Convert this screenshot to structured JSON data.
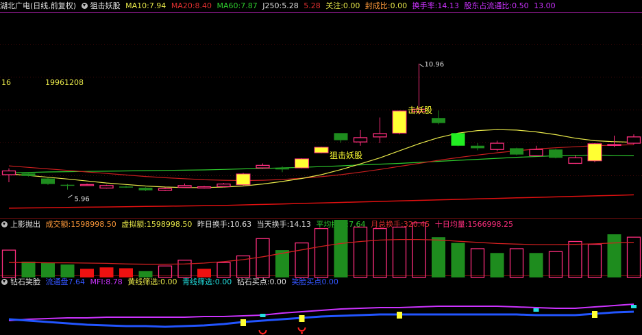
{
  "main_header": {
    "symbol": "湖北广电",
    "period": "(日线,前复权)",
    "indicator": "狙击妖股",
    "ma10_label": "MA10:",
    "ma10_value": "7.94",
    "ma20_label": "MA20:",
    "ma20_value": "8.40",
    "ma60_label": "MA60:",
    "ma60_value": "7.87",
    "j250_label": "J250:",
    "j250_value": "5.28",
    "v5_value": "5.28",
    "guanzhu_label": "关注:",
    "guanzhu_value": "0.00",
    "fengchengbi_label": "封成比:",
    "fengchengbi_value": "0.00",
    "huanshou_label": "换手率:",
    "huanshou_value": "14.13",
    "gudong_label": "股东占流通比:",
    "gudong_value": "0.50",
    "gudong_value2": "13.00"
  },
  "main_overlay": {
    "left_num": "16",
    "date_text": "19961208",
    "high_label": "10.96",
    "low_label": "5.96",
    "signal_text_1": "狙击妖股",
    "signal_text_2": "击妖股"
  },
  "volume_header": {
    "name": "上影抛出",
    "chengjiao_label": "成交额:",
    "chengjiao_value": "1598998.50",
    "xuni_label": "虚拟额:",
    "xuni_value": "1598998.50",
    "zuori_label": "昨日换手:",
    "zuori_value": "10.63",
    "dangtian_label": "当天换手:",
    "dangtian_value": "14.13",
    "pingjun_label": "平均换手:",
    "pingjun_value": "7.64",
    "yuezong_label": "月总换手:",
    "yuezong_value": "320.45",
    "shiri_label": "十日均量:",
    "shiri_value": "1566998.25"
  },
  "bottom_header": {
    "name": "钻石笑脸",
    "a_label": "流通盘",
    "a_value": "7.64",
    "mfi_label": "MFI:",
    "mfi_value": "8.78",
    "huang_label": "黄线筛选:",
    "huang_value": "0.00",
    "qing_label": "青线筛选:",
    "qing_value": "0.00",
    "mai_label": "钻石买点:",
    "mai_value": "0.00",
    "z_label": "笑脸买点",
    "z_value": "0.00"
  },
  "colors": {
    "up": "#ff2e7e",
    "down": "#1e8c1e",
    "ma10": "#e8e84a",
    "ma20": "#c81e1e",
    "ma60": "#2ecc2e",
    "long": "#e01010",
    "signal": "#ffff33",
    "cyan": "#22e0e0",
    "blue": "#2255ff",
    "magenta": "#cc33ff"
  },
  "chart_data": {
    "type": "candlestick",
    "candles": [
      {
        "o": 6.55,
        "h": 6.8,
        "l": 6.25,
        "c": 6.7,
        "signal": false
      },
      {
        "o": 6.6,
        "h": 6.65,
        "l": 6.48,
        "c": 6.5,
        "signal": false
      },
      {
        "o": 6.4,
        "h": 6.42,
        "l": 6.15,
        "c": 6.18,
        "signal": false
      },
      {
        "o": 6.15,
        "h": 6.18,
        "l": 5.96,
        "c": 6.14,
        "signal": false
      },
      {
        "o": 6.14,
        "h": 6.2,
        "l": 6.1,
        "c": 6.16,
        "signal": false
      },
      {
        "o": 6.02,
        "h": 6.15,
        "l": 6.0,
        "c": 6.12,
        "signal": false
      },
      {
        "o": 6.08,
        "h": 6.12,
        "l": 6.03,
        "c": 6.05,
        "signal": false
      },
      {
        "o": 6.03,
        "h": 6.05,
        "l": 5.9,
        "c": 5.93,
        "signal": false
      },
      {
        "o": 5.93,
        "h": 6.05,
        "l": 5.9,
        "c": 6.0,
        "signal": false
      },
      {
        "o": 6.05,
        "h": 6.2,
        "l": 6.02,
        "c": 6.12,
        "signal": false
      },
      {
        "o": 6.02,
        "h": 6.1,
        "l": 6.0,
        "c": 6.07,
        "signal": false
      },
      {
        "o": 6.08,
        "h": 6.22,
        "l": 6.05,
        "c": 6.18,
        "signal": false
      },
      {
        "o": 6.15,
        "h": 6.62,
        "l": 6.12,
        "c": 6.58,
        "signal": true
      },
      {
        "o": 6.82,
        "h": 7.0,
        "l": 6.78,
        "c": 6.92,
        "signal": false
      },
      {
        "o": 6.8,
        "h": 6.88,
        "l": 6.65,
        "c": 6.78,
        "signal": false
      },
      {
        "o": 6.82,
        "h": 7.2,
        "l": 6.8,
        "c": 7.18,
        "signal": true
      },
      {
        "o": 7.42,
        "h": 7.66,
        "l": 7.4,
        "c": 7.64,
        "signal": true
      },
      {
        "o": 8.2,
        "h": 8.2,
        "l": 7.82,
        "c": 7.92,
        "signal": false
      },
      {
        "o": 7.85,
        "h": 8.32,
        "l": 7.7,
        "c": 8.02,
        "signal": false
      },
      {
        "o": 8.05,
        "h": 8.82,
        "l": 7.8,
        "c": 8.18,
        "signal": false
      },
      {
        "o": 8.2,
        "h": 9.1,
        "l": 8.15,
        "c": 9.08,
        "signal": true
      },
      {
        "o": 9.05,
        "h": 10.96,
        "l": 8.95,
        "c": 9.15,
        "signal": false
      },
      {
        "o": 8.8,
        "h": 9.1,
        "l": 8.55,
        "c": 8.6,
        "signal": false
      },
      {
        "o": 8.2,
        "h": 8.2,
        "l": 7.68,
        "c": 7.7,
        "signal": false
      },
      {
        "o": 7.7,
        "h": 7.8,
        "l": 7.52,
        "c": 7.6,
        "signal": false
      },
      {
        "o": 7.55,
        "h": 7.9,
        "l": 7.48,
        "c": 7.8,
        "signal": false
      },
      {
        "o": 7.6,
        "h": 7.62,
        "l": 7.32,
        "c": 7.35,
        "signal": false
      },
      {
        "o": 7.3,
        "h": 7.7,
        "l": 7.28,
        "c": 7.55,
        "signal": false
      },
      {
        "o": 7.55,
        "h": 7.58,
        "l": 7.2,
        "c": 7.22,
        "signal": false
      },
      {
        "o": 7.0,
        "h": 7.32,
        "l": 6.98,
        "c": 7.22,
        "signal": false
      },
      {
        "o": 7.1,
        "h": 7.8,
        "l": 7.05,
        "c": 7.78,
        "signal": true
      },
      {
        "o": 7.72,
        "h": 8.1,
        "l": 7.65,
        "c": 7.75,
        "signal": false
      },
      {
        "o": 7.8,
        "h": 8.15,
        "l": 7.75,
        "c": 8.05,
        "signal": false
      }
    ],
    "ma10": [
      6.58,
      6.52,
      6.45,
      6.38,
      6.3,
      6.22,
      6.16,
      6.1,
      6.06,
      6.04,
      6.04,
      6.06,
      6.1,
      6.18,
      6.28,
      6.4,
      6.55,
      6.75,
      6.98,
      7.22,
      7.5,
      7.78,
      8.02,
      8.2,
      8.3,
      8.34,
      8.32,
      8.25,
      8.14,
      8.0,
      7.9,
      7.86,
      7.84
    ],
    "ma20": [
      6.9,
      6.84,
      6.78,
      6.72,
      6.66,
      6.6,
      6.54,
      6.48,
      6.43,
      6.39,
      6.35,
      6.33,
      6.32,
      6.33,
      6.36,
      6.41,
      6.47,
      6.55,
      6.65,
      6.76,
      6.88,
      7.0,
      7.12,
      7.23,
      7.33,
      7.42,
      7.5,
      7.57,
      7.62,
      7.66,
      7.7,
      7.72,
      7.74
    ],
    "ma60": [
      6.62,
      6.64,
      6.66,
      6.67,
      6.68,
      6.69,
      6.7,
      6.71,
      6.72,
      6.73,
      6.74,
      6.76,
      6.78,
      6.8,
      6.82,
      6.84,
      6.87,
      6.9,
      6.94,
      6.97,
      7.0,
      7.04,
      7.08,
      7.12,
      7.16,
      7.2,
      7.24,
      7.27,
      7.3,
      7.32,
      7.33,
      7.32,
      7.3
    ],
    "long_line": [
      5.22,
      5.23,
      5.24,
      5.25,
      5.26,
      5.27,
      5.28,
      5.29,
      5.3,
      5.31,
      5.32,
      5.33,
      5.35,
      5.37,
      5.39,
      5.41,
      5.43,
      5.45,
      5.47,
      5.49,
      5.51,
      5.53,
      5.55,
      5.57,
      5.59,
      5.61,
      5.63,
      5.65,
      5.67,
      5.69,
      5.71,
      5.73,
      5.75
    ],
    "volume": [
      {
        "v": 95,
        "up": true,
        "red": false
      },
      {
        "v": 55,
        "up": false,
        "red": false
      },
      {
        "v": 50,
        "up": false,
        "red": false
      },
      {
        "v": 45,
        "up": false,
        "red": false
      },
      {
        "v": 30,
        "up": false,
        "red": true
      },
      {
        "v": 35,
        "up": false,
        "red": true
      },
      {
        "v": 32,
        "up": false,
        "red": true
      },
      {
        "v": 22,
        "up": false,
        "red": false
      },
      {
        "v": 40,
        "up": true,
        "red": false
      },
      {
        "v": 60,
        "up": true,
        "red": false
      },
      {
        "v": 30,
        "up": false,
        "red": true
      },
      {
        "v": 52,
        "up": true,
        "red": false
      },
      {
        "v": 75,
        "up": true,
        "red": false
      },
      {
        "v": 135,
        "up": true,
        "red": false
      },
      {
        "v": 95,
        "up": false,
        "red": false
      },
      {
        "v": 120,
        "up": true,
        "red": false
      },
      {
        "v": 170,
        "up": true,
        "red": false
      },
      {
        "v": 200,
        "up": false,
        "red": false
      },
      {
        "v": 175,
        "up": true,
        "red": false
      },
      {
        "v": 170,
        "up": true,
        "red": false
      },
      {
        "v": 175,
        "up": true,
        "red": false
      },
      {
        "v": 190,
        "up": true,
        "red": false
      },
      {
        "v": 140,
        "up": false,
        "red": false
      },
      {
        "v": 120,
        "up": false,
        "red": false
      },
      {
        "v": 100,
        "up": true,
        "red": false
      },
      {
        "v": 85,
        "up": false,
        "red": false
      },
      {
        "v": 100,
        "up": true,
        "red": false
      },
      {
        "v": 85,
        "up": false,
        "red": false
      },
      {
        "v": 90,
        "up": true,
        "red": false
      },
      {
        "v": 125,
        "up": true,
        "red": false
      },
      {
        "v": 115,
        "up": true,
        "red": false
      },
      {
        "v": 150,
        "up": false,
        "red": false
      },
      {
        "v": 140,
        "up": true,
        "red": false
      }
    ],
    "volume_ma": [
      52,
      52,
      51,
      51,
      50,
      49,
      47,
      46,
      46,
      47,
      50,
      55,
      62,
      72,
      84,
      96,
      108,
      118,
      125,
      130,
      132,
      132,
      130,
      126,
      122,
      118,
      116,
      114,
      114,
      115,
      117,
      120,
      122
    ],
    "bottom_magenta": [
      52,
      50,
      49,
      48,
      48,
      47,
      47,
      47,
      47,
      47,
      46,
      46,
      45,
      44,
      41,
      39,
      37,
      35,
      34,
      33,
      33,
      32,
      31,
      31,
      31,
      31,
      32,
      33,
      34,
      34,
      32,
      30,
      28
    ],
    "bottom_blue": [
      50,
      52,
      54,
      56,
      58,
      59,
      60,
      60,
      61,
      60,
      59,
      57,
      54,
      52,
      50,
      48,
      46,
      45,
      44,
      43,
      43,
      43,
      43,
      43,
      43,
      43,
      43,
      44,
      44,
      44,
      42,
      40,
      39
    ],
    "bottom_marks": [
      {
        "i": 12,
        "t": "yellow"
      },
      {
        "i": 13,
        "t": "cyan"
      },
      {
        "i": 13,
        "t": "smiley"
      },
      {
        "i": 15,
        "t": "yellow"
      },
      {
        "i": 15,
        "t": "smiley"
      },
      {
        "i": 20,
        "t": "yellow"
      },
      {
        "i": 27,
        "t": "cyan"
      },
      {
        "i": 30,
        "t": "yellow"
      },
      {
        "i": 32,
        "t": "cyan"
      }
    ]
  }
}
